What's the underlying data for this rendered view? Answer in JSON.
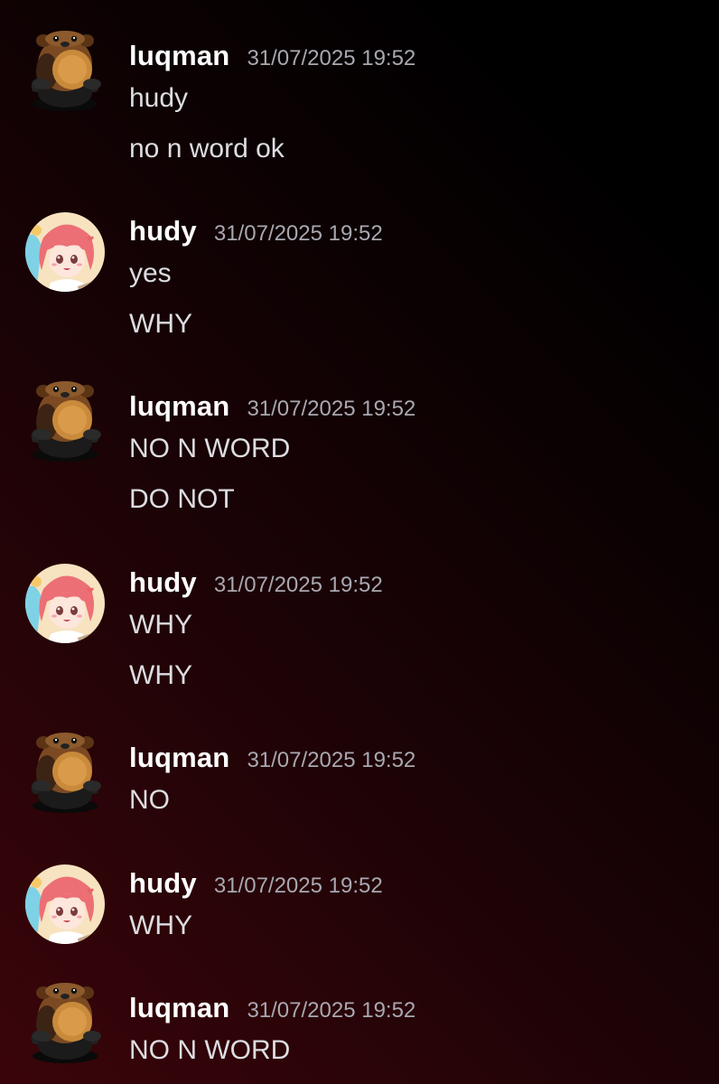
{
  "messages": [
    {
      "author": "luqman",
      "avatar": "bear-avatar",
      "timestamp": "31/07/2025 19:52",
      "lines": [
        "hudy",
        "no n word ok"
      ]
    },
    {
      "author": "hudy",
      "avatar": "anime-girl-avatar",
      "timestamp": "31/07/2025 19:52",
      "lines": [
        "yes",
        "WHY"
      ]
    },
    {
      "author": "luqman",
      "avatar": "bear-avatar",
      "timestamp": "31/07/2025 19:52",
      "lines": [
        "NO N WORD",
        "DO NOT"
      ]
    },
    {
      "author": "hudy",
      "avatar": "anime-girl-avatar",
      "timestamp": "31/07/2025 19:52",
      "lines": [
        "WHY",
        "WHY"
      ]
    },
    {
      "author": "luqman",
      "avatar": "bear-avatar",
      "timestamp": "31/07/2025 19:52",
      "lines": [
        "NO"
      ]
    },
    {
      "author": "hudy",
      "avatar": "anime-girl-avatar",
      "timestamp": "31/07/2025 19:52",
      "lines": [
        "WHY"
      ]
    },
    {
      "author": "luqman",
      "avatar": "bear-avatar",
      "timestamp": "31/07/2025 19:52",
      "lines": [
        "NO N WORD"
      ]
    }
  ],
  "colors": {
    "background_left": "#3a050a",
    "background_right": "#000000",
    "username": "#ffffff",
    "timestamp": "#a8a8b0",
    "message_text": "#dcdde1"
  }
}
